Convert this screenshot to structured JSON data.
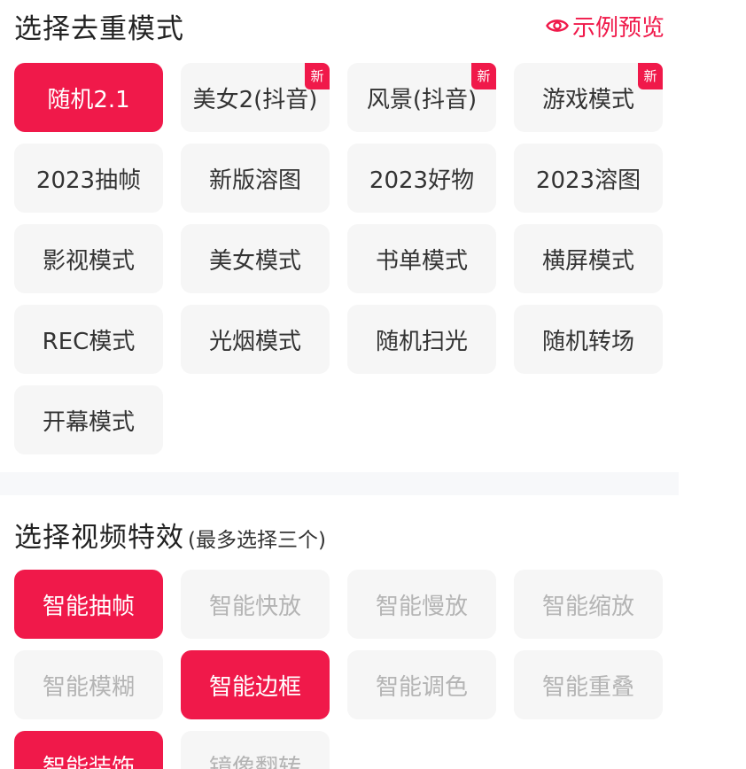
{
  "dedupe": {
    "title": "选择去重模式",
    "preview_label": "示例预览",
    "modes": [
      {
        "label": "随机2.1",
        "state": "active"
      },
      {
        "label": "美女2(抖音)",
        "state": "normal",
        "badge": "新"
      },
      {
        "label": "风景(抖音)",
        "state": "normal",
        "badge": "新"
      },
      {
        "label": "游戏模式",
        "state": "normal",
        "badge": "新"
      },
      {
        "label": "2023抽帧",
        "state": "normal"
      },
      {
        "label": "新版溶图",
        "state": "normal"
      },
      {
        "label": "2023好物",
        "state": "normal"
      },
      {
        "label": "2023溶图",
        "state": "normal"
      },
      {
        "label": "影视模式",
        "state": "normal"
      },
      {
        "label": "美女模式",
        "state": "normal"
      },
      {
        "label": "书单模式",
        "state": "normal"
      },
      {
        "label": "横屏模式",
        "state": "normal"
      },
      {
        "label": "REC模式",
        "state": "normal"
      },
      {
        "label": "光烟模式",
        "state": "normal"
      },
      {
        "label": "随机扫光",
        "state": "normal"
      },
      {
        "label": "随机转场",
        "state": "normal"
      },
      {
        "label": "开幕模式",
        "state": "normal"
      }
    ]
  },
  "effects": {
    "title": "选择视频特效",
    "subtitle": "(最多选择三个)",
    "items": [
      {
        "label": "智能抽帧",
        "state": "active"
      },
      {
        "label": "智能快放",
        "state": "disabled"
      },
      {
        "label": "智能慢放",
        "state": "disabled"
      },
      {
        "label": "智能缩放",
        "state": "disabled"
      },
      {
        "label": "智能模糊",
        "state": "disabled"
      },
      {
        "label": "智能边框",
        "state": "active"
      },
      {
        "label": "智能调色",
        "state": "disabled"
      },
      {
        "label": "智能重叠",
        "state": "disabled"
      },
      {
        "label": "智能装饰",
        "state": "active"
      },
      {
        "label": "镜像翻转",
        "state": "disabled"
      }
    ]
  },
  "icons": {
    "preview": "eye-icon"
  },
  "colors": {
    "accent": "#f0194a",
    "chip_bg": "#f6f6f6",
    "text": "#333333",
    "disabled_text": "#b4b4b4"
  }
}
